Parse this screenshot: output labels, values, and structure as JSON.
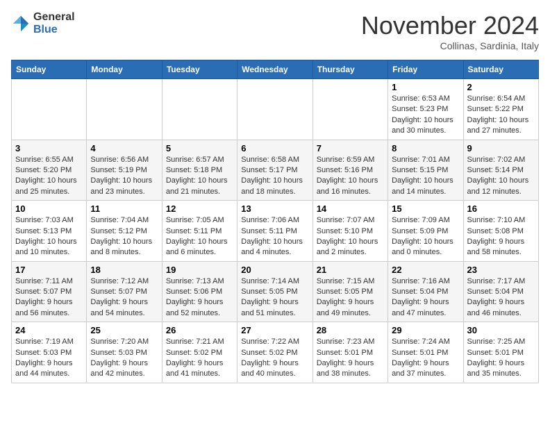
{
  "header": {
    "logo_general": "General",
    "logo_blue": "Blue",
    "month": "November 2024",
    "location": "Collinas, Sardinia, Italy"
  },
  "weekdays": [
    "Sunday",
    "Monday",
    "Tuesday",
    "Wednesday",
    "Thursday",
    "Friday",
    "Saturday"
  ],
  "weeks": [
    [
      {
        "day": "",
        "info": ""
      },
      {
        "day": "",
        "info": ""
      },
      {
        "day": "",
        "info": ""
      },
      {
        "day": "",
        "info": ""
      },
      {
        "day": "",
        "info": ""
      },
      {
        "day": "1",
        "info": "Sunrise: 6:53 AM\nSunset: 5:23 PM\nDaylight: 10 hours and 30 minutes."
      },
      {
        "day": "2",
        "info": "Sunrise: 6:54 AM\nSunset: 5:22 PM\nDaylight: 10 hours and 27 minutes."
      }
    ],
    [
      {
        "day": "3",
        "info": "Sunrise: 6:55 AM\nSunset: 5:20 PM\nDaylight: 10 hours and 25 minutes."
      },
      {
        "day": "4",
        "info": "Sunrise: 6:56 AM\nSunset: 5:19 PM\nDaylight: 10 hours and 23 minutes."
      },
      {
        "day": "5",
        "info": "Sunrise: 6:57 AM\nSunset: 5:18 PM\nDaylight: 10 hours and 21 minutes."
      },
      {
        "day": "6",
        "info": "Sunrise: 6:58 AM\nSunset: 5:17 PM\nDaylight: 10 hours and 18 minutes."
      },
      {
        "day": "7",
        "info": "Sunrise: 6:59 AM\nSunset: 5:16 PM\nDaylight: 10 hours and 16 minutes."
      },
      {
        "day": "8",
        "info": "Sunrise: 7:01 AM\nSunset: 5:15 PM\nDaylight: 10 hours and 14 minutes."
      },
      {
        "day": "9",
        "info": "Sunrise: 7:02 AM\nSunset: 5:14 PM\nDaylight: 10 hours and 12 minutes."
      }
    ],
    [
      {
        "day": "10",
        "info": "Sunrise: 7:03 AM\nSunset: 5:13 PM\nDaylight: 10 hours and 10 minutes."
      },
      {
        "day": "11",
        "info": "Sunrise: 7:04 AM\nSunset: 5:12 PM\nDaylight: 10 hours and 8 minutes."
      },
      {
        "day": "12",
        "info": "Sunrise: 7:05 AM\nSunset: 5:11 PM\nDaylight: 10 hours and 6 minutes."
      },
      {
        "day": "13",
        "info": "Sunrise: 7:06 AM\nSunset: 5:11 PM\nDaylight: 10 hours and 4 minutes."
      },
      {
        "day": "14",
        "info": "Sunrise: 7:07 AM\nSunset: 5:10 PM\nDaylight: 10 hours and 2 minutes."
      },
      {
        "day": "15",
        "info": "Sunrise: 7:09 AM\nSunset: 5:09 PM\nDaylight: 10 hours and 0 minutes."
      },
      {
        "day": "16",
        "info": "Sunrise: 7:10 AM\nSunset: 5:08 PM\nDaylight: 9 hours and 58 minutes."
      }
    ],
    [
      {
        "day": "17",
        "info": "Sunrise: 7:11 AM\nSunset: 5:07 PM\nDaylight: 9 hours and 56 minutes."
      },
      {
        "day": "18",
        "info": "Sunrise: 7:12 AM\nSunset: 5:07 PM\nDaylight: 9 hours and 54 minutes."
      },
      {
        "day": "19",
        "info": "Sunrise: 7:13 AM\nSunset: 5:06 PM\nDaylight: 9 hours and 52 minutes."
      },
      {
        "day": "20",
        "info": "Sunrise: 7:14 AM\nSunset: 5:05 PM\nDaylight: 9 hours and 51 minutes."
      },
      {
        "day": "21",
        "info": "Sunrise: 7:15 AM\nSunset: 5:05 PM\nDaylight: 9 hours and 49 minutes."
      },
      {
        "day": "22",
        "info": "Sunrise: 7:16 AM\nSunset: 5:04 PM\nDaylight: 9 hours and 47 minutes."
      },
      {
        "day": "23",
        "info": "Sunrise: 7:17 AM\nSunset: 5:04 PM\nDaylight: 9 hours and 46 minutes."
      }
    ],
    [
      {
        "day": "24",
        "info": "Sunrise: 7:19 AM\nSunset: 5:03 PM\nDaylight: 9 hours and 44 minutes."
      },
      {
        "day": "25",
        "info": "Sunrise: 7:20 AM\nSunset: 5:03 PM\nDaylight: 9 hours and 42 minutes."
      },
      {
        "day": "26",
        "info": "Sunrise: 7:21 AM\nSunset: 5:02 PM\nDaylight: 9 hours and 41 minutes."
      },
      {
        "day": "27",
        "info": "Sunrise: 7:22 AM\nSunset: 5:02 PM\nDaylight: 9 hours and 40 minutes."
      },
      {
        "day": "28",
        "info": "Sunrise: 7:23 AM\nSunset: 5:01 PM\nDaylight: 9 hours and 38 minutes."
      },
      {
        "day": "29",
        "info": "Sunrise: 7:24 AM\nSunset: 5:01 PM\nDaylight: 9 hours and 37 minutes."
      },
      {
        "day": "30",
        "info": "Sunrise: 7:25 AM\nSunset: 5:01 PM\nDaylight: 9 hours and 35 minutes."
      }
    ]
  ]
}
